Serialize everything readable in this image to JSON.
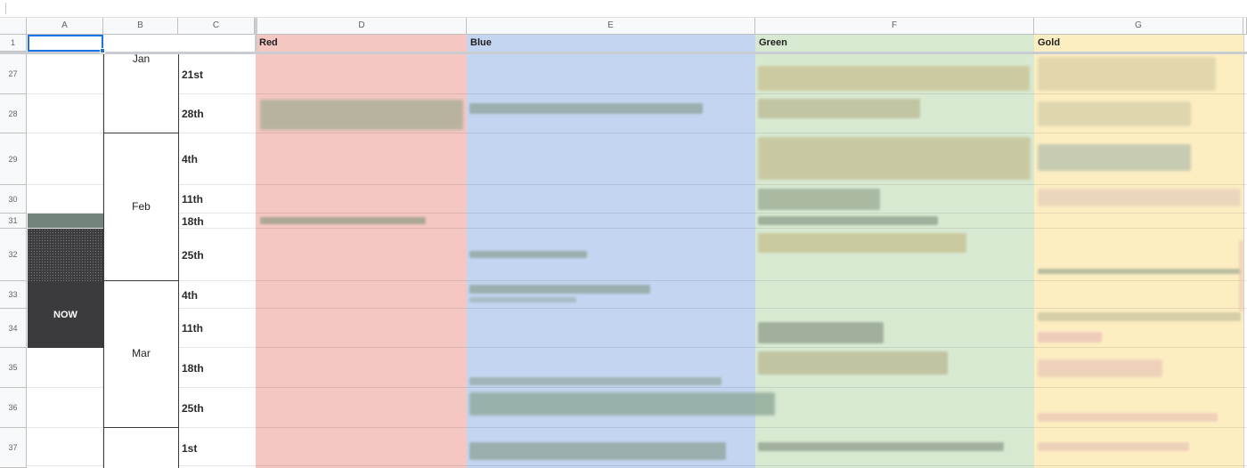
{
  "columns": [
    "A",
    "B",
    "C",
    "D",
    "E",
    "F",
    "G"
  ],
  "rows": [
    "1",
    "27",
    "28",
    "29",
    "30",
    "31",
    "32",
    "33",
    "34",
    "35",
    "36",
    "37"
  ],
  "headers": {
    "red": "Red",
    "blue": "Blue",
    "green": "Green",
    "gold": "Gold"
  },
  "months": {
    "jan": "Jan",
    "feb": "Feb",
    "mar": "Mar"
  },
  "dates": [
    "21st",
    "28th",
    "4th",
    "11th",
    "18th",
    "25th",
    "4th",
    "11th",
    "18th",
    "25th",
    "1st"
  ],
  "now_label": "NOW",
  "colors": {
    "red": "#f4c7c3",
    "blue": "#c3d5f0",
    "green": "#d8e9d2",
    "gold": "#fdeec2",
    "now": "#3b3b3d",
    "selection": "#1a73e8"
  }
}
